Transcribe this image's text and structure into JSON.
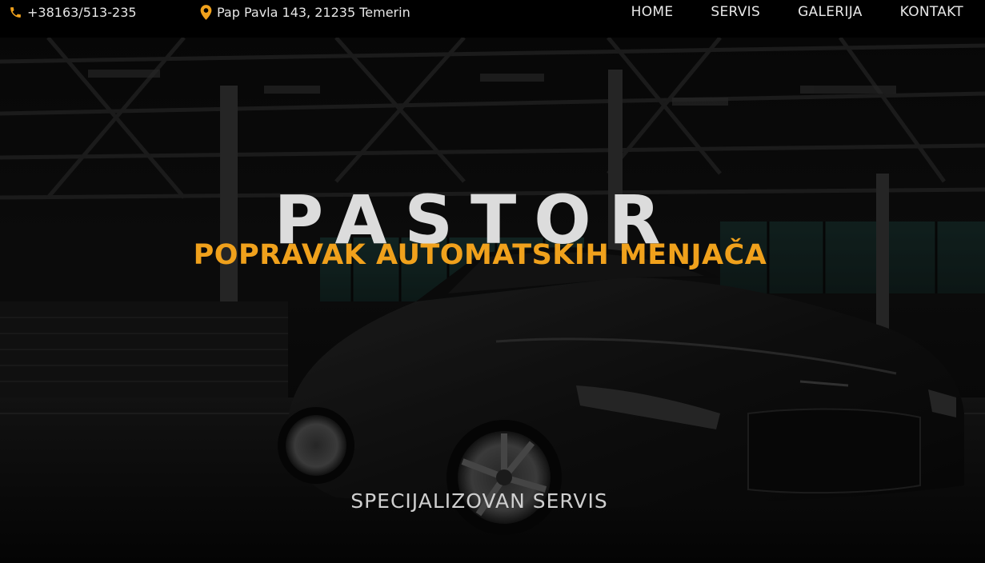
{
  "topbar": {
    "phone": {
      "icon": "phone-icon",
      "text": "+38163/513-235"
    },
    "address": {
      "icon": "map-marker-icon",
      "text": "Pap Pavla 143, 21235 Temerin"
    },
    "nav": [
      {
        "label": "HOME"
      },
      {
        "label": "SERVIS"
      },
      {
        "label": "GALERIJA"
      },
      {
        "label": "KONTAKT"
      }
    ]
  },
  "hero": {
    "title": "PASTOR",
    "subtitle": "POPRAVAK AUTOMATSKIH MENJAČA",
    "tagline": "SPECIJALIZOVAN SERVIS",
    "background": "dark-garage-sports-car-photo"
  },
  "colors": {
    "accent": "#f0a11c",
    "topbar_bg": "#000000",
    "text_light": "#e6e6e6"
  }
}
